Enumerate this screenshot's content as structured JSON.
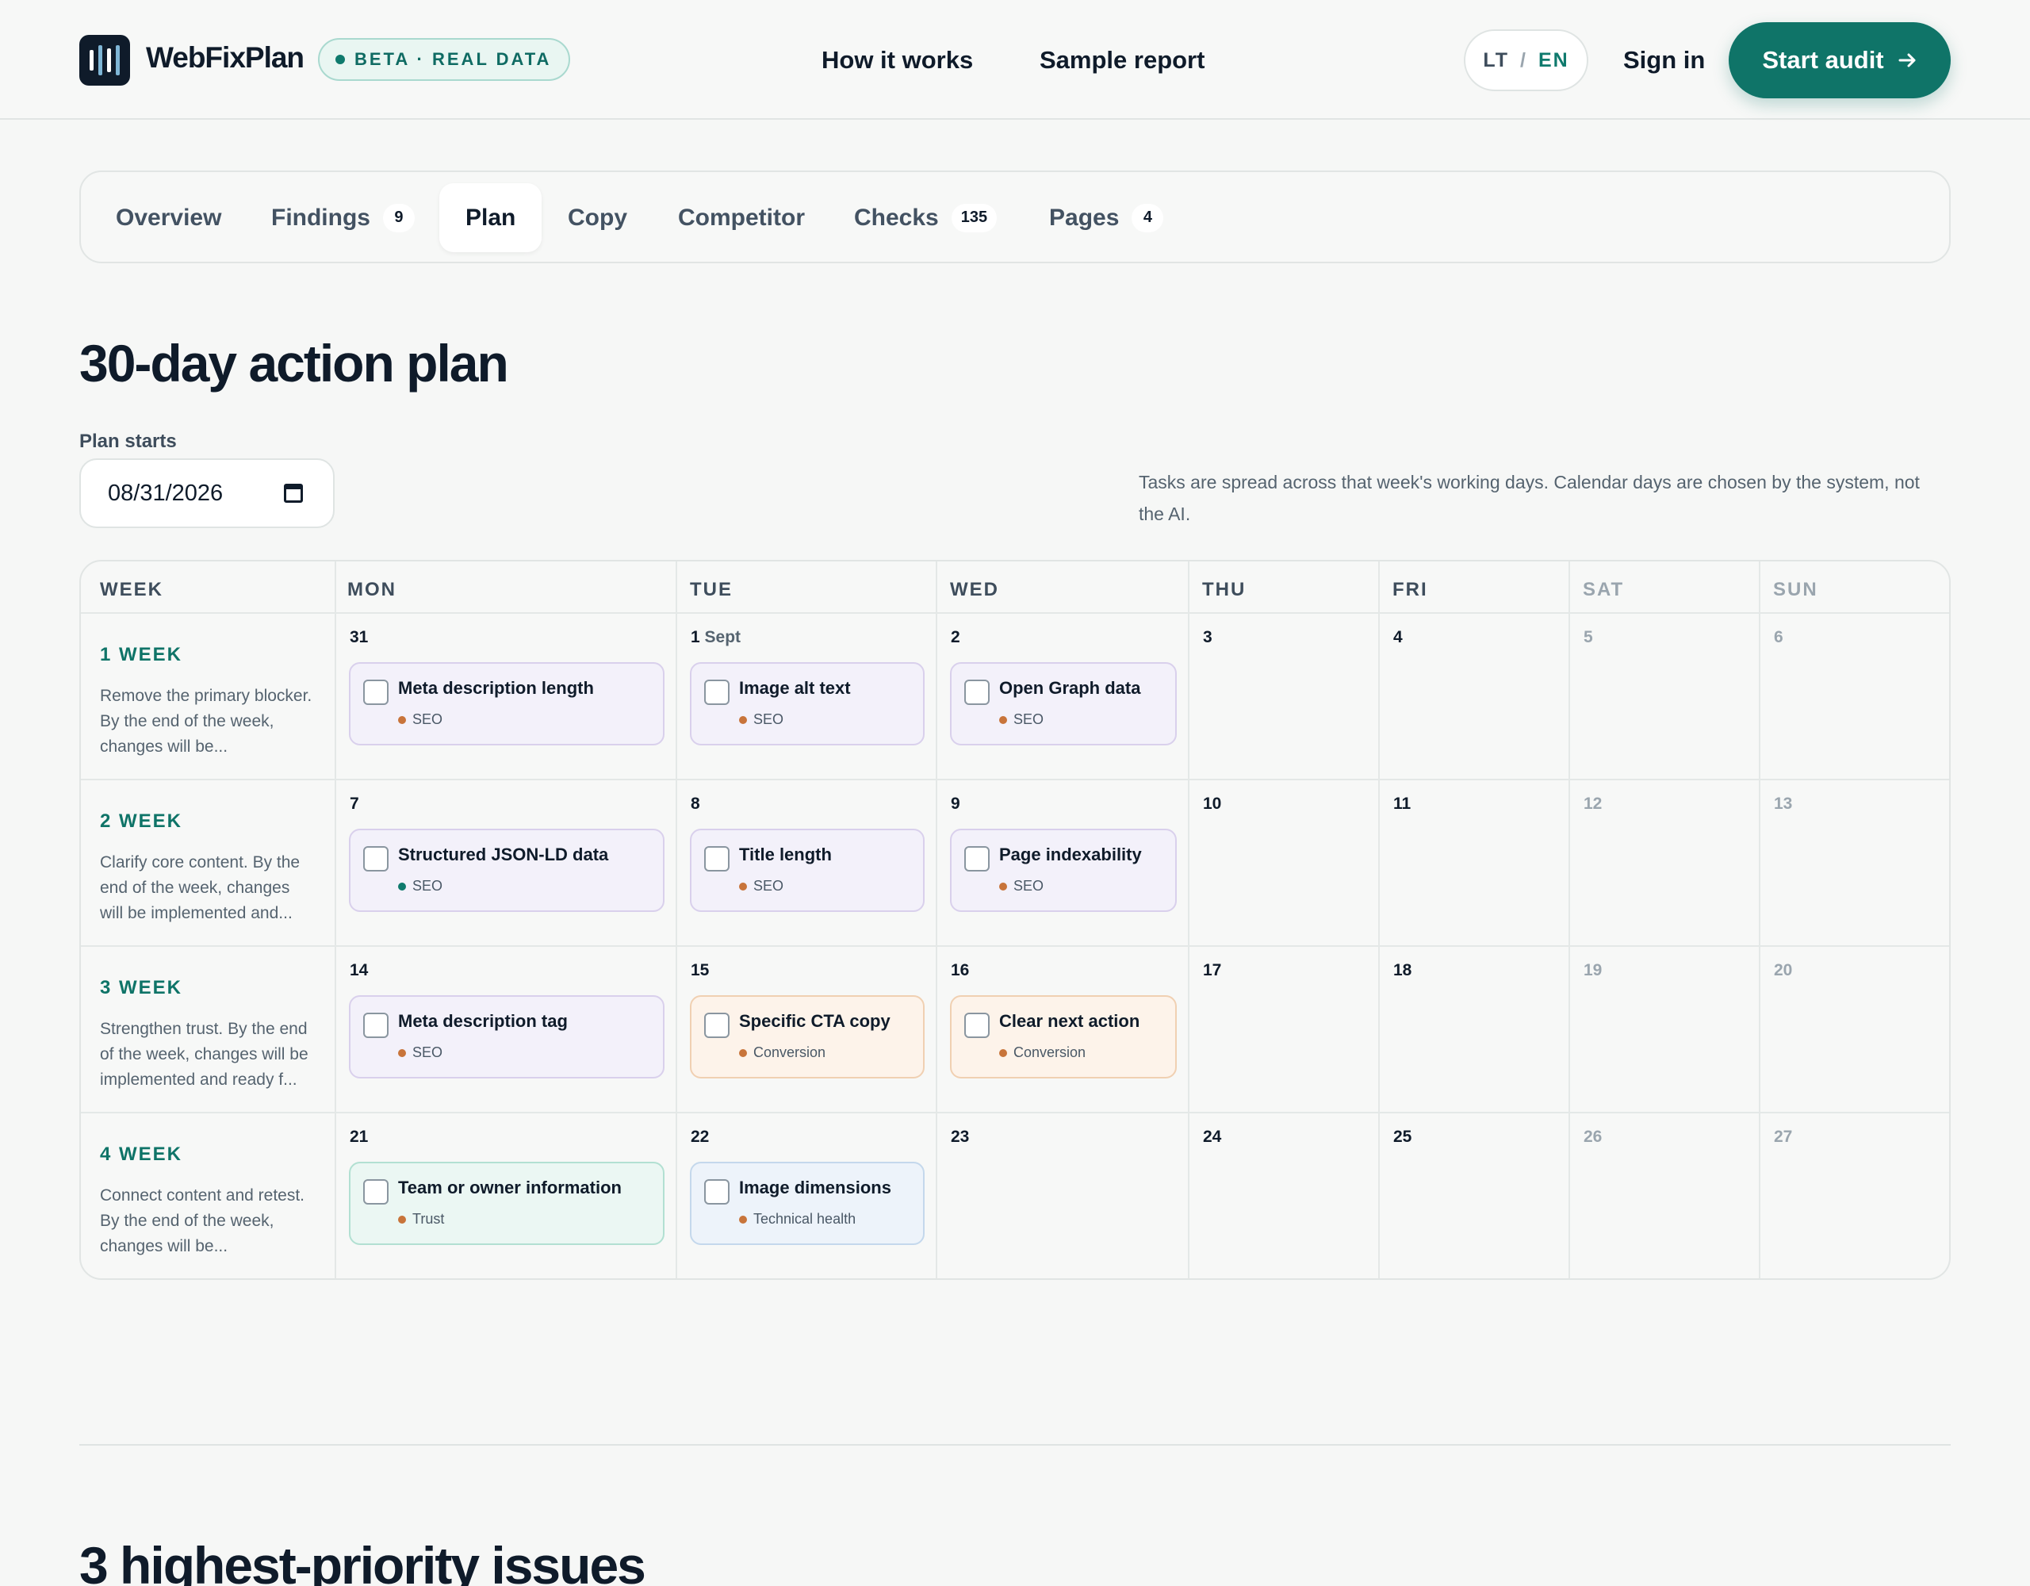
{
  "header": {
    "brand": "WebFixPlan",
    "beta_badge": "BETA · REAL DATA",
    "nav": [
      "How it works",
      "Sample report"
    ],
    "lang_lt": "LT",
    "lang_sep": "/",
    "lang_en": "EN",
    "sign_in": "Sign in",
    "start_audit": "Start audit",
    "accent_color": "#0f7468"
  },
  "tabs": [
    {
      "label": "Overview",
      "count": ""
    },
    {
      "label": "Findings",
      "count": "9"
    },
    {
      "label": "Plan",
      "count": ""
    },
    {
      "label": "Copy",
      "count": ""
    },
    {
      "label": "Competitor",
      "count": ""
    },
    {
      "label": "Checks",
      "count": "135"
    },
    {
      "label": "Pages",
      "count": "4"
    }
  ],
  "active_tab": "Plan",
  "plan": {
    "title": "30-day action plan",
    "start_label": "Plan starts",
    "start_date": "08/31/2026",
    "note": "Tasks are spread across that week's working days. Calendar days are chosen by the system, not the AI.",
    "columns": [
      "WEEK",
      "MON",
      "TUE",
      "WED",
      "THU",
      "FRI",
      "SAT",
      "SUN"
    ],
    "weeks": [
      {
        "title": "1 WEEK",
        "desc": "Remove the primary blocker. By the end of the week, changes will be...",
        "days": [
          "31",
          "1",
          "2",
          "3",
          "4",
          "5",
          "6"
        ],
        "month_label": "Sept",
        "tasks": [
          {
            "day": 0,
            "name": "Meta description length",
            "category": "SEO"
          },
          {
            "day": 1,
            "name": "Image alt text",
            "category": "SEO"
          },
          {
            "day": 2,
            "name": "Open Graph data",
            "category": "SEO"
          }
        ]
      },
      {
        "title": "2 WEEK",
        "desc": "Clarify core content. By the end of the week, changes will be implemented and...",
        "days": [
          "7",
          "8",
          "9",
          "10",
          "11",
          "12",
          "13"
        ],
        "tasks": [
          {
            "day": 0,
            "name": "Structured JSON-LD data",
            "category": "SEO"
          },
          {
            "day": 1,
            "name": "Title length",
            "category": "SEO"
          },
          {
            "day": 2,
            "name": "Page indexability",
            "category": "SEO"
          }
        ]
      },
      {
        "title": "3 WEEK",
        "desc": "Strengthen trust. By the end of the week, changes will be implemented and ready f...",
        "days": [
          "14",
          "15",
          "16",
          "17",
          "18",
          "19",
          "20"
        ],
        "tasks": [
          {
            "day": 0,
            "name": "Meta description tag",
            "category": "SEO"
          },
          {
            "day": 1,
            "name": "Specific CTA copy",
            "category": "Conversion"
          },
          {
            "day": 2,
            "name": "Clear next action",
            "category": "Conversion"
          }
        ]
      },
      {
        "title": "4 WEEK",
        "desc": "Connect content and retest. By the end of the week, changes will be...",
        "days": [
          "21",
          "22",
          "23",
          "24",
          "25",
          "26",
          "27"
        ],
        "tasks": [
          {
            "day": 0,
            "name": "Team or owner information",
            "category": "Trust"
          },
          {
            "day": 1,
            "name": "Image dimensions",
            "category": "Technical health"
          }
        ]
      }
    ]
  },
  "next_section_title": "3 highest-priority issues"
}
